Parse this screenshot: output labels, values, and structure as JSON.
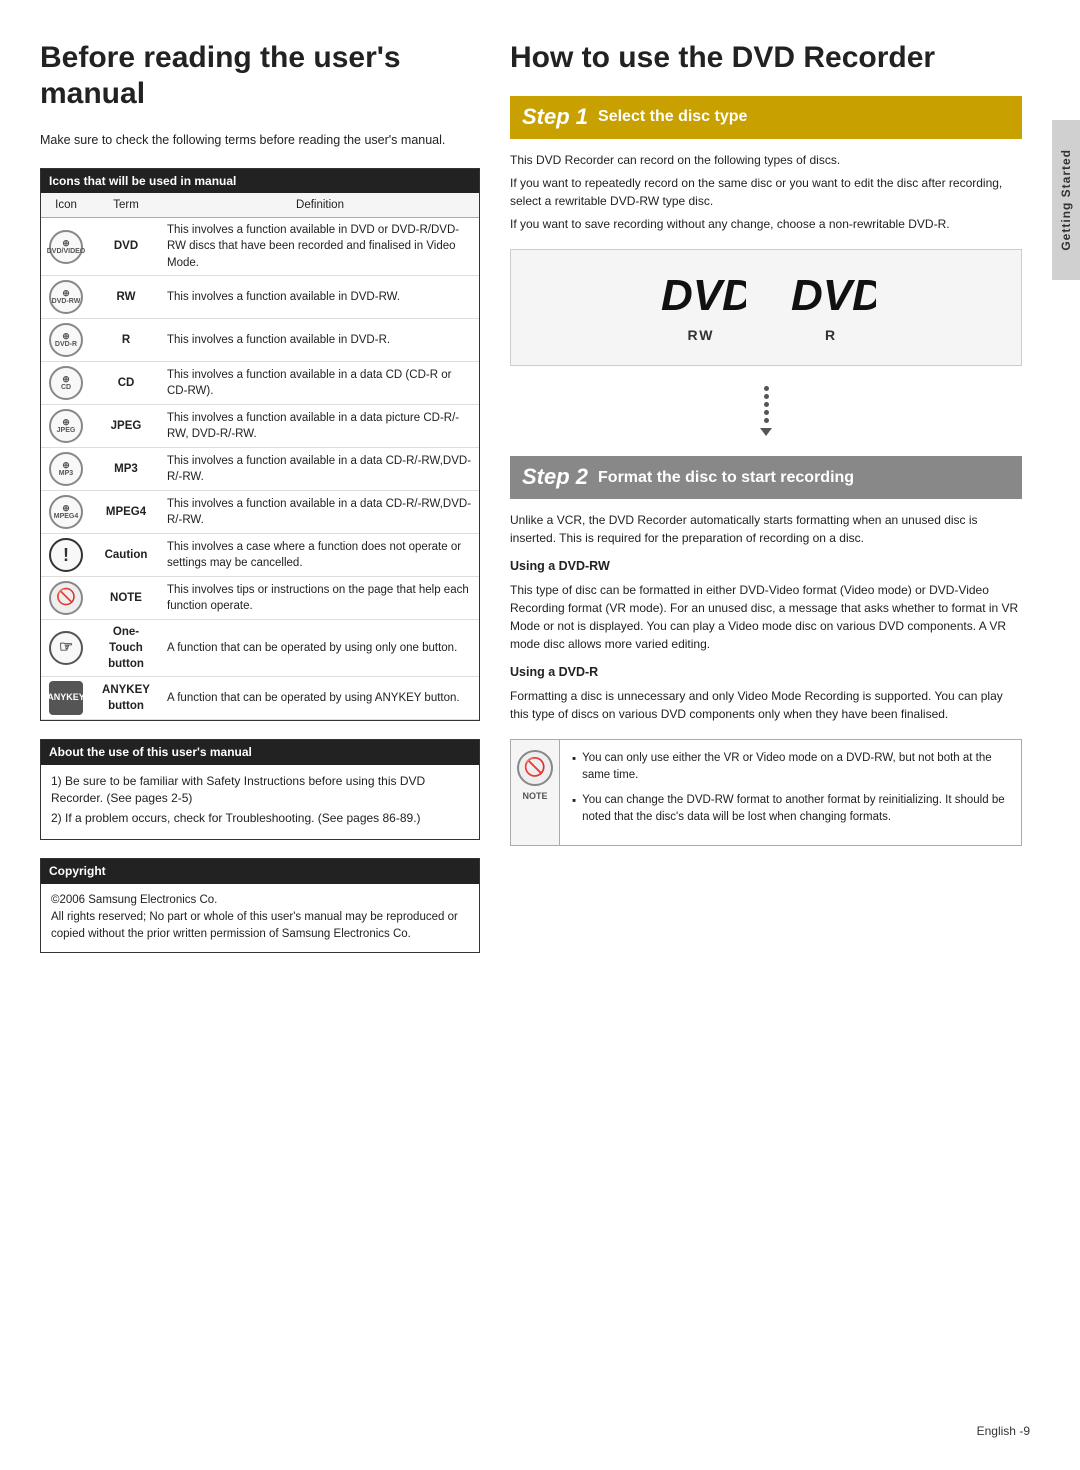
{
  "left": {
    "title": "Before reading the user's manual",
    "intro": "Make sure to check the following terms before reading the user's manual.",
    "icons_section_header": "Icons that will be used in manual",
    "table_headers": [
      "Icon",
      "Term",
      "Definition"
    ],
    "table_rows": [
      {
        "icon_type": "dvd-icon",
        "icon_label": "DVD/VIDEO",
        "term": "DVD",
        "definition": "This involves a function available in DVD or DVD-R/DVD-RW discs that have been recorded and finalised in Video Mode."
      },
      {
        "icon_type": "rw-icon",
        "icon_label": "DVD-RW",
        "term": "RW",
        "definition": "This involves a function available in DVD-RW."
      },
      {
        "icon_type": "r-icon",
        "icon_label": "DVD-R",
        "term": "R",
        "definition": "This involves a function available in DVD-R."
      },
      {
        "icon_type": "cd-icon",
        "icon_label": "CD",
        "term": "CD",
        "definition": "This involves a function available in a data CD (CD-R or CD-RW)."
      },
      {
        "icon_type": "jpeg-icon",
        "icon_label": "JPEG",
        "term": "JPEG",
        "definition": "This involves a function available in a data picture CD-R/-RW, DVD-R/-RW."
      },
      {
        "icon_type": "mp3-icon",
        "icon_label": "MP3",
        "term": "MP3",
        "definition": "This involves a function available in a data CD-R/-RW,DVD-R/-RW."
      },
      {
        "icon_type": "mpeg4-icon",
        "icon_label": "MPEG4",
        "term": "MPEG4",
        "definition": "This involves a function available in a data CD-R/-RW,DVD-R/-RW."
      },
      {
        "icon_type": "caution-icon",
        "icon_label": "!",
        "term": "Caution",
        "definition": "This involves a case where a function does not operate or settings may be cancelled."
      },
      {
        "icon_type": "note-icon",
        "icon_label": "NOTE",
        "term": "NOTE",
        "definition": "This involves tips or instructions on the page that help each function operate."
      },
      {
        "icon_type": "hand-icon",
        "icon_label": "ONE-TOUCH",
        "term_line1": "One-Touch",
        "term_line2": "button",
        "definition": "A function that can be operated by using only one button."
      },
      {
        "icon_type": "anykey-icon",
        "icon_label": "ANYKEY",
        "term_line1": "ANYKEY",
        "term_line2": "button",
        "definition": "A function that can be operated by using ANYKEY button."
      }
    ],
    "about_header": "About the use of this user's manual",
    "about_items": [
      "1) Be sure to be familiar with Safety Instructions before using this DVD Recorder. (See pages 2-5)",
      "2) If a problem occurs, check for Troubleshooting. (See pages 86-89.)"
    ],
    "copyright_header": "Copyright",
    "copyright_text": "©2006 Samsung Electronics Co.\nAll rights reserved; No part or whole of this user's manual may be reproduced or copied without the prior written permission of Samsung Electronics Co."
  },
  "right": {
    "title": "How to use the DVD Recorder",
    "step1": {
      "number": "Step 1",
      "label": "Select the disc type",
      "content_lines": [
        "This DVD Recorder can record on the following types of discs.",
        "If you want to repeatedly record on the same disc or you want to edit the disc after recording, select a rewritable DVD-RW type disc.",
        "If you want to save recording without any change, choose a non-rewritable DVD-R."
      ],
      "dvd_rw_label": "RW",
      "dvd_r_label": "R"
    },
    "step2": {
      "number": "Step 2",
      "label": "Format the disc to start recording",
      "intro": "Unlike a VCR, the DVD Recorder automatically starts formatting when an unused disc is inserted. This is required for the preparation of recording on a disc.",
      "using_dvdrw_title": "Using a DVD-RW",
      "using_dvdrw_text": "This type of disc can be formatted in either DVD-Video format (Video mode) or DVD-Video Recording format (VR mode). For an unused disc, a message that asks whether to format in VR Mode or not is displayed. You can play a Video mode disc on various DVD components. A VR mode disc allows more varied editing.",
      "using_dvdr_title": "Using a DVD-R",
      "using_dvdr_text": "Formatting a disc is unnecessary and only Video Mode Recording is supported. You can play this type of discs on various DVD components only when they have been finalised.",
      "note_items": [
        "You can only use either the VR or Video mode on a DVD-RW, but not both at the same time.",
        "You can change the DVD-RW format to another format by reinitializing. It should be noted that the disc's data will be lost when changing formats."
      ]
    }
  },
  "sidebar": {
    "label": "Getting Started"
  },
  "footer": {
    "text": "English -9"
  }
}
